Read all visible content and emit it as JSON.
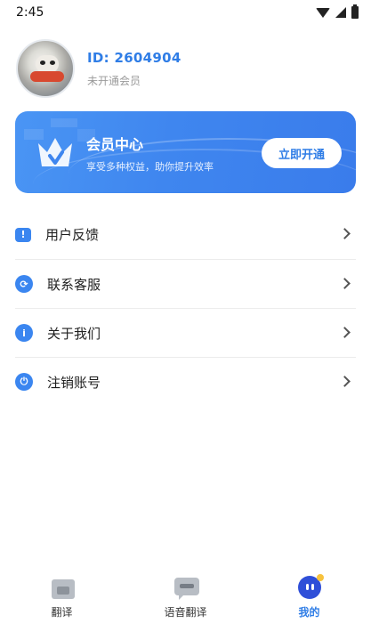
{
  "status_bar": {
    "time": "2:45"
  },
  "profile": {
    "id_text": "ID: 2604904",
    "member_status": "未开通会员"
  },
  "vip": {
    "title": "会员中心",
    "subtitle": "享受多种权益，助你提升效率",
    "button": "立即开通"
  },
  "menu": {
    "items": [
      {
        "label": "用户反馈",
        "icon": "feedback-icon",
        "color": "#3b86f0"
      },
      {
        "label": "联系客服",
        "icon": "customer-service-icon",
        "color": "#3b86f0"
      },
      {
        "label": "关于我们",
        "icon": "info-icon",
        "color": "#3b86f0"
      },
      {
        "label": "注销账号",
        "icon": "power-icon",
        "color": "#3b86f0"
      }
    ]
  },
  "bottom_nav": {
    "items": [
      {
        "label": "翻译",
        "icon": "translate-icon",
        "active": false
      },
      {
        "label": "语音翻译",
        "icon": "voice-translate-icon",
        "active": false
      },
      {
        "label": "我的",
        "icon": "profile-icon",
        "active": true
      }
    ]
  },
  "colors": {
    "accent": "#2f7de6",
    "banner": "#4a95f4"
  }
}
